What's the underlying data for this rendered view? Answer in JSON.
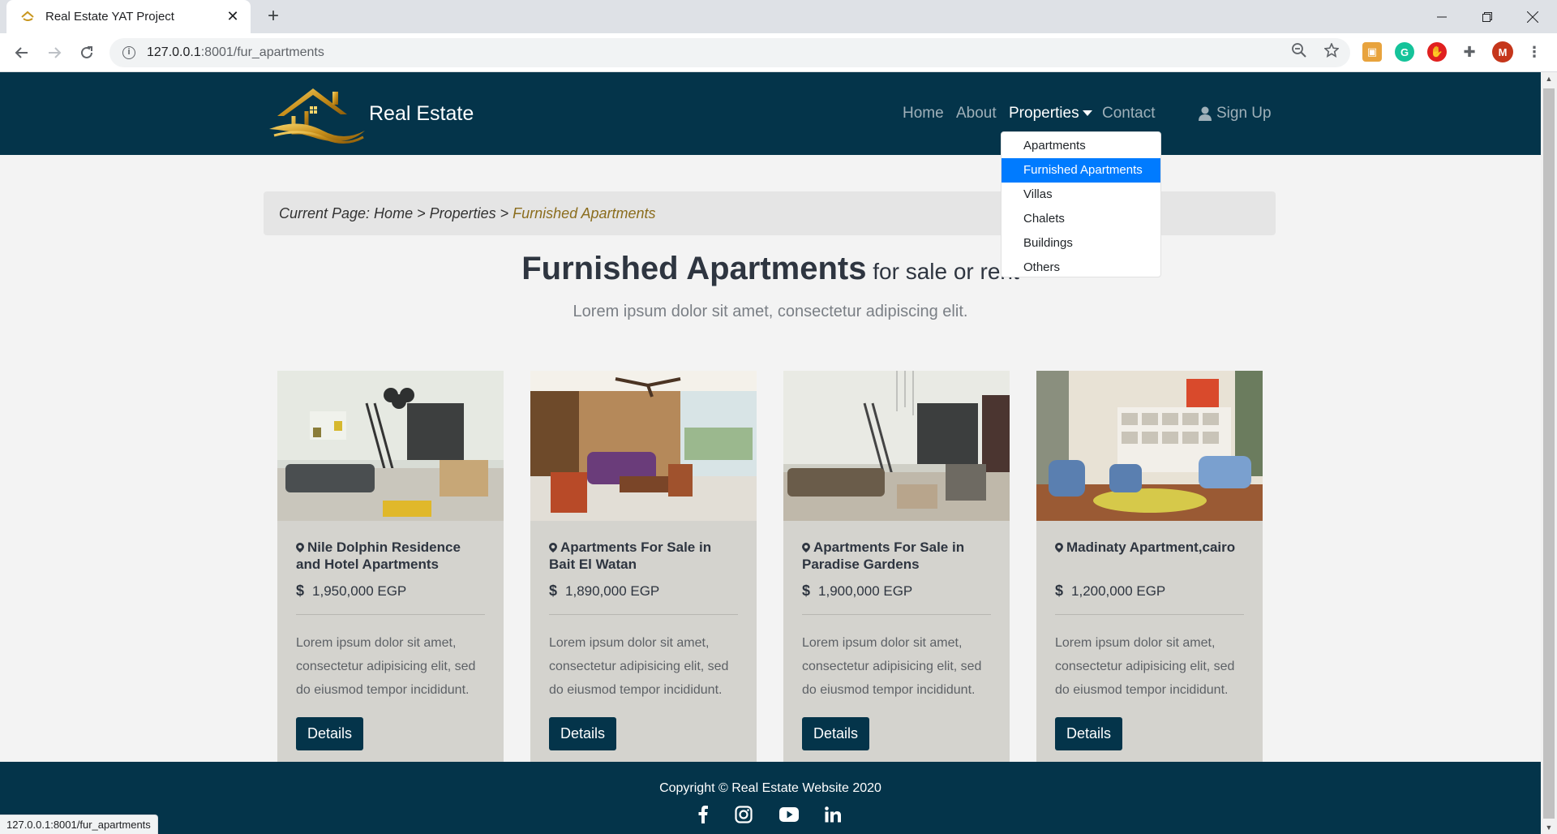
{
  "browser": {
    "tab_title": "Real Estate YAT Project",
    "url_host": "127.0.0.1",
    "url_rest": ":8001/fur_apartments",
    "status_url": "127.0.0.1:8001/fur_apartments",
    "profile_initial": "M"
  },
  "nav": {
    "brand": "Real Estate",
    "items": [
      {
        "label": "Home"
      },
      {
        "label": "About"
      },
      {
        "label": "Properties"
      },
      {
        "label": "Contact"
      }
    ],
    "signup": "Sign Up",
    "dropdown": [
      "Apartments",
      "Furnished Apartments",
      "Villas",
      "Chalets",
      "Buildings",
      "Others"
    ],
    "dropdown_selected": "Furnished Apartments"
  },
  "breadcrumb": {
    "prefix": "Current Page: Home > Properties > ",
    "current": "Furnished Apartments"
  },
  "heading": {
    "strong": "Furnished Apartments",
    "light": " for sale or rent"
  },
  "subtitle": "Lorem ipsum dolor sit amet, consectetur adipiscing elit.",
  "cards": [
    {
      "title": "Nile Dolphin Residence and Hotel Apartments",
      "price": "1,950,000 EGP",
      "desc": "Lorem ipsum dolor sit amet, consectetur adipisicing elit, sed do eiusmod tempor incididunt.",
      "button": "Details"
    },
    {
      "title": "Apartments For Sale in Bait El Watan",
      "price": "1,890,000 EGP",
      "desc": "Lorem ipsum dolor sit amet, consectetur adipisicing elit, sed do eiusmod tempor incididunt.",
      "button": "Details"
    },
    {
      "title": "Apartments For Sale in Paradise Gardens",
      "price": "1,900,000 EGP",
      "desc": "Lorem ipsum dolor sit amet, consectetur adipisicing elit, sed do eiusmod tempor incididunt.",
      "button": "Details"
    },
    {
      "title": "Madinaty Apartment,cairo",
      "price": "1,200,000 EGP",
      "desc": "Lorem ipsum dolor sit amet, consectetur adipisicing elit, sed do eiusmod tempor incididunt.",
      "button": "Details"
    }
  ],
  "footer": {
    "copyright": "Copyright © Real Estate Website 2020",
    "social_icons": [
      "facebook-icon",
      "instagram-icon",
      "youtube-icon",
      "linkedin-icon"
    ]
  },
  "colors": {
    "navy": "#04344a",
    "card_bg": "#d4d3ce",
    "accent_gold": "#8b6d1e",
    "dropdown_selected": "#007bff"
  }
}
